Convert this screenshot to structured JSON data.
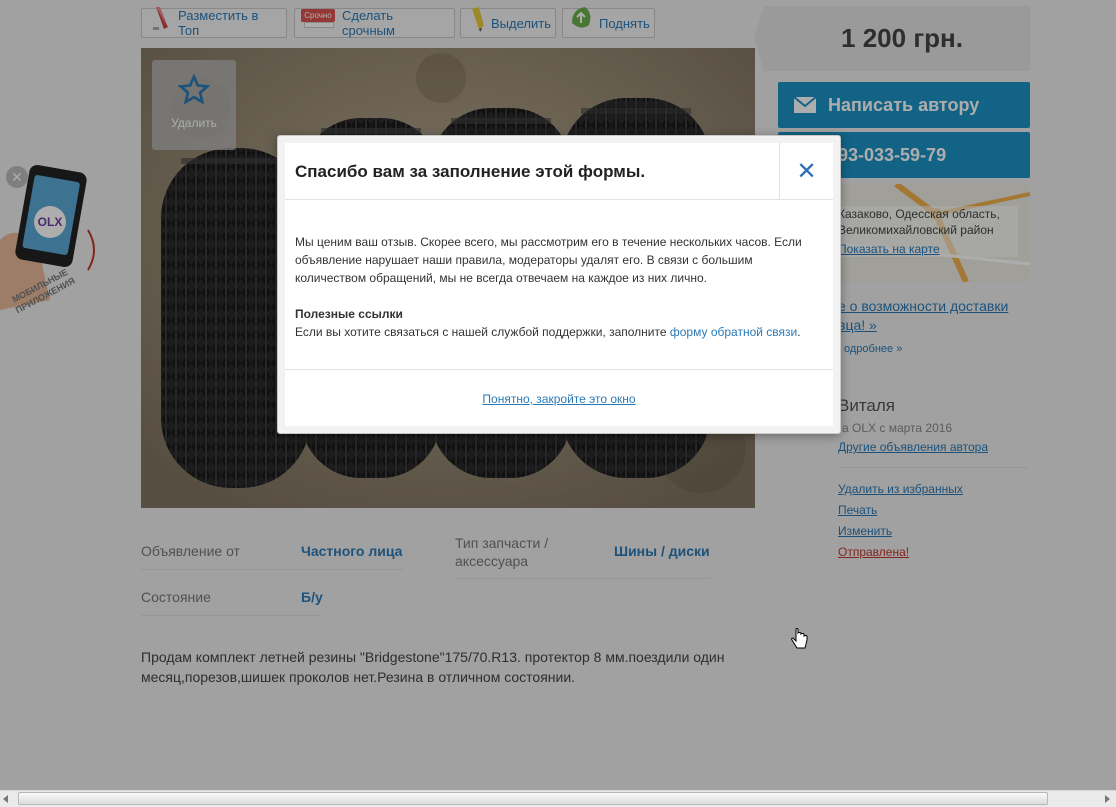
{
  "promo_buttons": [
    {
      "label": "Разместить в Топ",
      "icon": "rocket-icon"
    },
    {
      "label": "Сделать срочным",
      "icon": "urgent-icon",
      "badge": "Срочно"
    },
    {
      "label": "Выделить",
      "icon": "marker-icon"
    },
    {
      "label": "Поднять",
      "icon": "up-arrow-icon"
    }
  ],
  "favorite": {
    "label": "Удалить",
    "icon": "star-icon"
  },
  "price": "1 200 грн.",
  "contact": {
    "write_label": "Написать автору",
    "phone": "93-033-59-79"
  },
  "location": {
    "line1": "Казаково, Одесская область,",
    "line2": "Великомихайловский район",
    "map_link": "Показать на карте"
  },
  "delivery": {
    "link": "е о возможности доставки вца! »",
    "more": "одробнее »"
  },
  "seller": {
    "name": "Виталя",
    "since": "а OLX с марта 2016",
    "other_ads": "Другие объявления автора"
  },
  "actions": {
    "remove_fav": "Удалить из избранных",
    "print": "Печать",
    "edit": "Изменить",
    "sent": "Отправлена!"
  },
  "specs": [
    {
      "label": "Объявление от",
      "value": "Частного лица"
    },
    {
      "label": "Состояние",
      "value": "Б/у"
    },
    {
      "label": "Тип запчасти / аксессуара",
      "value": "Шины / диски"
    }
  ],
  "description": "Продам комплект летней резины \"Bridgestone\"175/70.R13. протектор 8 мм.поездили один месяц,порезов,шишек проколов нет.Резина в отличном состоянии.",
  "app_promo": {
    "label_line1": "МОБИЛЬНЫЕ",
    "label_line2": "ПРИЛОЖЕНИЯ",
    "logo": "OLX"
  },
  "modal": {
    "title": "Спасибо вам за заполнение этой формы.",
    "body": "Мы ценим ваш отзыв. Скорее всего, мы рассмотрим его в течение нескольких часов. Если объявление нарушает наши правила, модераторы удалят его. В связи с большим количеством обращений, мы не всегда отвечаем на каждое из них лично.",
    "links_heading": "Полезные ссылки",
    "support_text": "Если вы хотите связаться с нашей службой поддержки, заполните",
    "support_link": "форму обратной связи",
    "support_period": ".",
    "close_link": "Понятно, закройте это окно"
  },
  "colors": {
    "accent": "#1b93c5",
    "link": "#2a7ab5",
    "sent": "#c0392b"
  }
}
